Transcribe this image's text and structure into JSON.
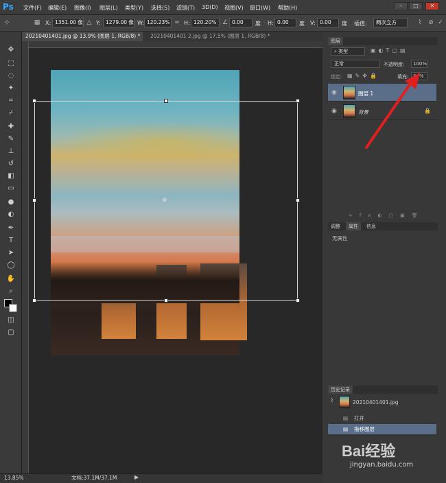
{
  "app": {
    "logo": "Ps"
  },
  "menubar": {
    "items": [
      "文件(F)",
      "编辑(E)",
      "图像(I)",
      "图层(L)",
      "类型(Y)",
      "选择(S)",
      "滤镜(T)",
      "3D(D)",
      "视图(V)",
      "窗口(W)",
      "帮助(H)"
    ],
    "window_controls": [
      "–",
      "□",
      "✕"
    ]
  },
  "options": {
    "x_label": "X:",
    "x_value": "1351.00 像",
    "y_label": "Y:",
    "y_value": "1279.00 像",
    "w_label": "W:",
    "w_value": "120.23%",
    "h_label": "H:",
    "h_value": "120.20%",
    "angle_value": "0.00",
    "angle_unit": "度",
    "hskew_label": "H:",
    "hskew_value": "0.00",
    "hskew_unit": "度",
    "vskew_label": "V:",
    "vskew_value": "0.00",
    "vskew_unit": "度",
    "interp_label": "插值:",
    "interp_value": "两次立方"
  },
  "tabs": [
    {
      "label": "20210401401.jpg @ 13.9% (图层 1, RGB/8) *",
      "active": true
    },
    {
      "label": "20210401401 2.jpg @ 17.5% (图层 1, RGB/8) *",
      "active": false
    }
  ],
  "status": {
    "zoom": "13.85%",
    "doc": "文档:37.1M/37.1M"
  },
  "layers_panel": {
    "tab": "图层",
    "filter_label": "类型",
    "blend_mode": "正常",
    "opacity_label": "不透明度:",
    "opacity_value": "100%",
    "lock_label": "锁定:",
    "fill_label": "填充:",
    "fill_value": "44%",
    "layers": [
      {
        "name": "图层 1",
        "selected": true
      },
      {
        "name": "背景",
        "selected": false
      }
    ]
  },
  "properties_panel": {
    "tabs": [
      "调整",
      "属性",
      "信息"
    ],
    "active_tab": "属性",
    "empty_text": "无属性"
  },
  "history_panel": {
    "tab": "历史记录",
    "snapshot": "20210401401.jpg",
    "steps": [
      "打开",
      "拖移图层"
    ]
  },
  "watermark": {
    "brand": "Bai经验",
    "url": "jingyan.baidu.com"
  },
  "colors": {
    "accent": "#31a8ff",
    "selected_row": "#5a6e8a",
    "annotation_arrow": "#e02020"
  }
}
